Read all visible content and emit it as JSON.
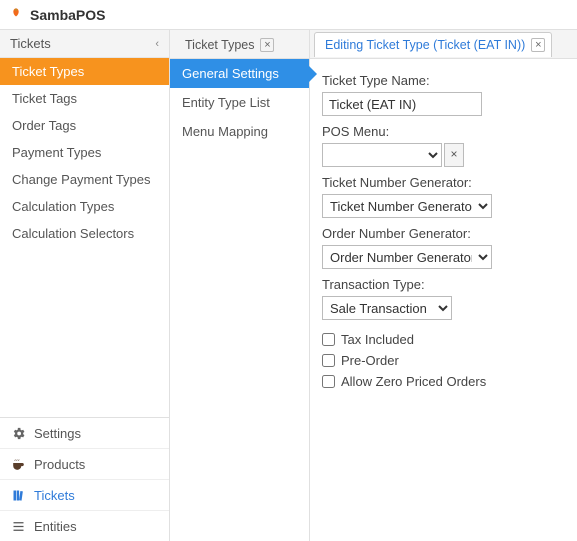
{
  "app": {
    "title": "SambaPOS"
  },
  "sidebar": {
    "header": "Tickets",
    "items": [
      {
        "label": "Ticket Types",
        "selected": true
      },
      {
        "label": "Ticket Tags"
      },
      {
        "label": "Order Tags"
      },
      {
        "label": "Payment Types"
      },
      {
        "label": "Change Payment Types"
      },
      {
        "label": "Calculation Types"
      },
      {
        "label": "Calculation Selectors"
      }
    ],
    "modules": [
      {
        "label": "Settings",
        "icon": "gear"
      },
      {
        "label": "Products",
        "icon": "coffee"
      },
      {
        "label": "Tickets",
        "icon": "books",
        "active": true
      },
      {
        "label": "Entities",
        "icon": "list"
      }
    ]
  },
  "subnav": {
    "tab": {
      "label": "Ticket Types"
    },
    "items": [
      {
        "label": "General Settings",
        "selected": true
      },
      {
        "label": "Entity Type List"
      },
      {
        "label": "Menu Mapping"
      }
    ]
  },
  "editor": {
    "tab": {
      "label": "Editing Ticket Type (Ticket (EAT IN))"
    },
    "fields": {
      "ticketTypeName": {
        "label": "Ticket Type Name:",
        "value": "Ticket (EAT IN)"
      },
      "posMenu": {
        "label": "POS Menu:",
        "value": ""
      },
      "ticketNumberGenerator": {
        "label": "Ticket Number Generator:",
        "value": "Ticket Number Generator"
      },
      "orderNumberGenerator": {
        "label": "Order Number Generator:",
        "value": "Order Number Generator"
      },
      "transactionType": {
        "label": "Transaction Type:",
        "value": "Sale Transaction"
      },
      "taxIncluded": {
        "label": "Tax Included",
        "checked": false
      },
      "preOrder": {
        "label": "Pre-Order",
        "checked": false
      },
      "allowZeroPriced": {
        "label": "Allow Zero Priced Orders",
        "checked": false
      }
    }
  }
}
